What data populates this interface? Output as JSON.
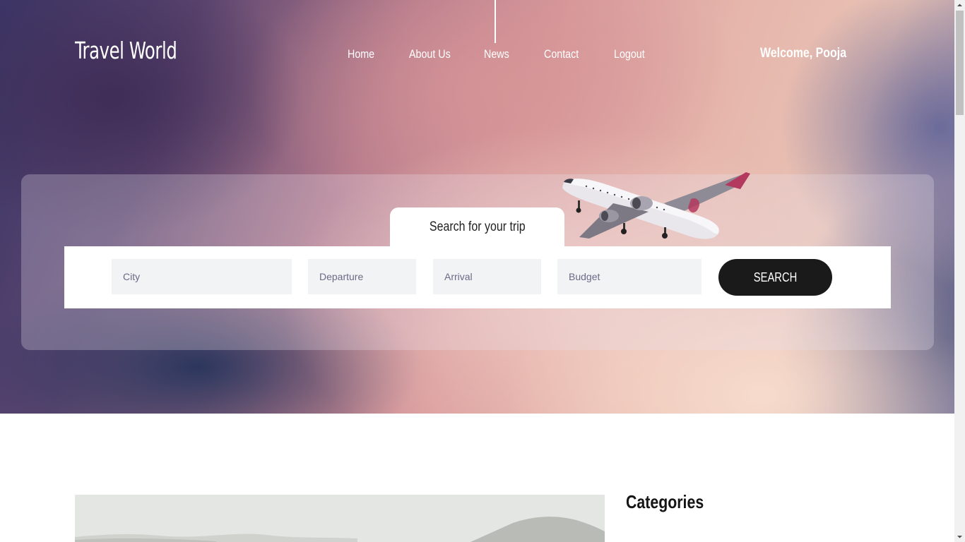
{
  "header": {
    "brand": "Travel World",
    "nav": [
      "Home",
      "About Us",
      "News",
      "Contact",
      "Logout"
    ],
    "welcome": "Welcome, Pooja"
  },
  "search": {
    "tab_label": "Search for your trip",
    "city_placeholder": "City",
    "departure_placeholder": "Departure",
    "arrival_placeholder": "Arrival",
    "budget_placeholder": "Budget",
    "button_label": "SEARCH"
  },
  "sidebar": {
    "categories_title": "Categories"
  },
  "icons": {
    "hero_image": "airplane-image",
    "scroll_up": "chevron-up-icon",
    "scroll_down": "chevron-down-icon"
  },
  "colors": {
    "button_bg": "#1a1a1a",
    "field_bg": "#f1f3f5",
    "nav_text": "#ffffff"
  }
}
